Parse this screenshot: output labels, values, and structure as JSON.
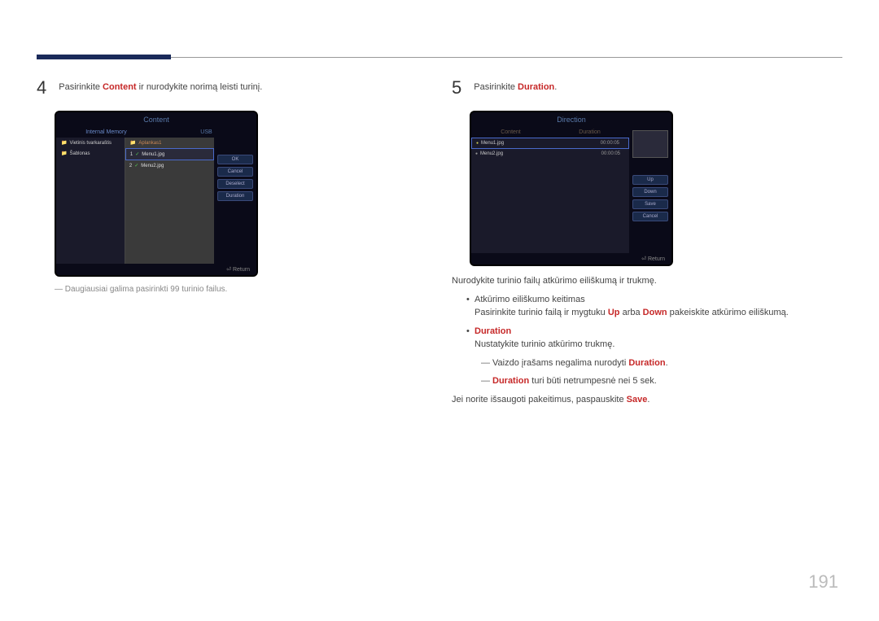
{
  "page_number": "191",
  "left": {
    "step_num": "4",
    "step_text_pre": "Pasirinkite ",
    "step_text_hl": "Content",
    "step_text_post": " ir nurodykite norimą leisti turinį.",
    "screen_title": "Content",
    "tabs": {
      "left": "Internal Memory",
      "right": "USB"
    },
    "folders": [
      "Vietinis tvarkaraštis",
      "Šablonas"
    ],
    "folder_right": "Aplankas1",
    "files": [
      {
        "idx": "1",
        "name": "Menu1.jpg",
        "selected": true
      },
      {
        "idx": "2",
        "name": "Menu2.jpg",
        "selected": false
      }
    ],
    "buttons": [
      "OK",
      "Cancel",
      "Deselect",
      "Duration"
    ],
    "return": "Return",
    "note": "Daugiausiai galima pasirinkti 99 turinio failus."
  },
  "right": {
    "step_num": "5",
    "step_text_pre": "Pasirinkite ",
    "step_text_hl": "Duration",
    "step_text_post": ".",
    "screen_title": "Direction",
    "headers": {
      "content": "Content",
      "duration": "Duration"
    },
    "rows": [
      {
        "name": "Menu1.jpg",
        "dur": "00:00:05",
        "sel": true,
        "dot": "y"
      },
      {
        "name": "Menu2.jpg",
        "dur": "00:00:05",
        "sel": false,
        "dot": "g"
      }
    ],
    "buttons": [
      "Up",
      "Down",
      "Save",
      "Cancel"
    ],
    "return": "Return",
    "para1": "Nurodykite turinio failų atkūrimo eiliškumą ir trukmę.",
    "b1_title": "Atkūrimo eiliškumo keitimas",
    "b1_text_pre": "Pasirinkite turinio failą ir mygtuku ",
    "b1_up": "Up",
    "b1_mid": " arba ",
    "b1_down": "Down",
    "b1_post": " pakeiskite atkūrimo eiliškumą.",
    "b2_hl": "Duration",
    "b2_text": "Nustatykite turinio atkūrimo trukmę.",
    "b2_sub1_pre": "Vaizdo įrašams negalima nurodyti ",
    "b2_sub1_hl": "Duration",
    "b2_sub1_post": ".",
    "b2_sub2_hl": "Duration",
    "b2_sub2_post": " turi būti netrumpesnė nei 5 sek.",
    "save_pre": "Jei norite išsaugoti pakeitimus, paspauskite ",
    "save_hl": "Save",
    "save_post": "."
  }
}
